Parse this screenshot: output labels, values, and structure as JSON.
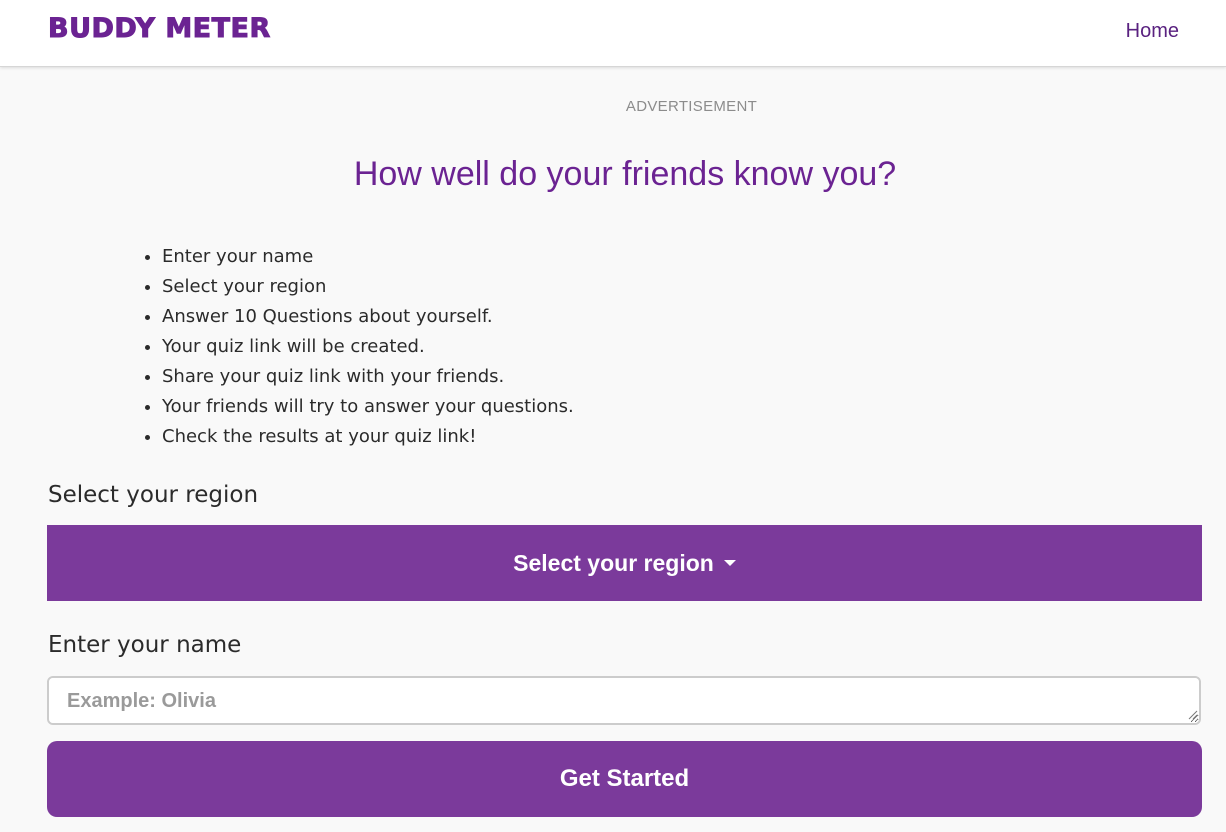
{
  "navbar": {
    "brand": "BUDDY METER",
    "home_link": "Home"
  },
  "advertisement_label": "ADVERTISEMENT",
  "headline": "How well do your friends know you?",
  "steps": [
    "Enter your name",
    "Select your region",
    "Answer 10 Questions about yourself.",
    "Your quiz link will be created.",
    "Share your quiz link with your friends.",
    "Your friends will try to answer your questions.",
    "Check the results at your quiz link!"
  ],
  "region": {
    "label": "Select your region",
    "dropdown_text": "Select your region"
  },
  "name": {
    "label": "Enter your name",
    "placeholder": "Example: Olivia",
    "value": ""
  },
  "start_button": "Get Started",
  "colors": {
    "brand_purple": "#6b2392",
    "button_purple": "#7b3a9b",
    "page_background": "#f9f9f9"
  }
}
